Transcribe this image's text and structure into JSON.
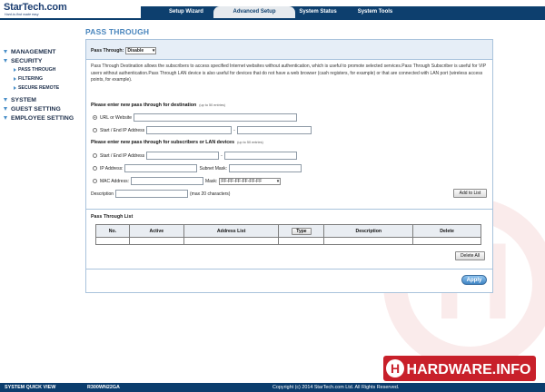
{
  "brand": {
    "name": "StarTech.com",
    "tagline": "Hard-to-find made easy"
  },
  "nav": {
    "tabs": [
      {
        "label": "Setup Wizard",
        "active": false
      },
      {
        "label": "Advanced Setup",
        "active": true
      },
      {
        "label": "System Status",
        "active": false
      },
      {
        "label": "System Tools",
        "active": false
      }
    ]
  },
  "sidebar": {
    "items": [
      {
        "label": "MANAGEMENT"
      },
      {
        "label": "SECURITY"
      },
      {
        "label": "PASS THROUGH"
      },
      {
        "label": "FILTERING"
      },
      {
        "label": "SECURE REMOTE"
      },
      {
        "label": "SYSTEM"
      },
      {
        "label": "GUEST SETTING"
      },
      {
        "label": "EMPLOYEE SETTING"
      }
    ]
  },
  "page": {
    "title": "PASS THROUGH",
    "pass_through_label": "Pass Through:",
    "pass_through_value": "Disable",
    "description": "Pass Through Destination allows the subscribers to access specified Internet websites without authentication, which is useful to promote selected services.Pass Through Subscriber is useful for VIP users without authentication.Pass Through LAN device is also useful for devices that do not have a web browser (cash registers, for example) or that are connected with LAN port (wireless access points, for example).",
    "dest_header": "Please enter new pass through for destination",
    "dest_note": "(up to 50 entries)",
    "url_label": "URL or Website",
    "start_end_ip_label": "Start / End IP Address",
    "dash": "-",
    "sub_header": "Please enter new pass through for subscribers or LAN devices",
    "sub_note": "(up to 50 entries)",
    "ip_label": "IP Address:",
    "subnet_label": "Subnet Mask:",
    "mac_label": "MAC Address:",
    "mask_label": "Mask:",
    "mask_value": "FF-FF-FF-FF-FF-FF",
    "description_label": "Description",
    "description_note": "(max 20 characters)",
    "add_button": "Add to List",
    "list_title": "Pass Through List",
    "columns": {
      "no": "No.",
      "active": "Active",
      "address_list": "Address List",
      "type": "Type",
      "description": "Description",
      "delete": "Delete"
    },
    "delete_all_button": "Delete All",
    "apply_button": "Apply"
  },
  "footer": {
    "quick_view": "SYSTEM QUICK VIEW",
    "model": "R300WN22GA",
    "copyright": "Copyright (c) 2014 StarTech.com Ltd. All Rights Reserved."
  },
  "watermark": {
    "text": "HARDWARE.INFO"
  },
  "colors": {
    "nav_bg": "#0d3f6e",
    "accent": "#4a86bd",
    "panel_band": "#e6eef7",
    "footer_bg": "#0b3d6d",
    "watermark_red": "#c8202a"
  }
}
